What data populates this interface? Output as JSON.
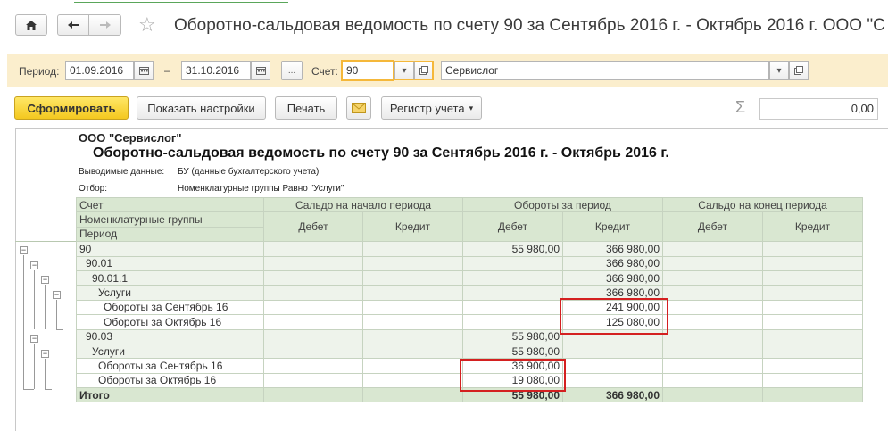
{
  "window": {
    "title": "Оборотно-сальдовая ведомость по счету 90 за Сентябрь 2016 г. - Октябрь 2016 г. ООО \"С"
  },
  "params": {
    "period_label": "Период:",
    "date_from": "01.09.2016",
    "dash": "–",
    "date_to": "31.10.2016",
    "more_button": "...",
    "account_label": "Счет:",
    "account_value": "90",
    "org_value": "Сервислог"
  },
  "toolbar": {
    "generate": "Сформировать",
    "settings": "Показать настройки",
    "print": "Печать",
    "register": "Регистр учета",
    "sum_value": "0,00"
  },
  "report": {
    "company": "ООО \"Сервислог\"",
    "title": "Оборотно-сальдовая ведомость по счету 90 за Сентябрь 2016 г. - Октябрь 2016 г.",
    "output_label": "Выводимые данные:",
    "output_value": "БУ (данные бухгалтерского учета)",
    "filter_label": "Отбор:",
    "filter_value": "Номенклатурные группы Равно \"Услуги\"",
    "headers": {
      "col_account": "Счет",
      "col_group": "Номенклатурные группы",
      "col_period": "Период",
      "opening": "Сальдо на начало периода",
      "turnover": "Обороты за период",
      "closing": "Сальдо на конец периода",
      "debit": "Дебет",
      "credit": "Кредит"
    },
    "rows": [
      {
        "label": "90",
        "od": "",
        "oc": "",
        "td": "55 980,00",
        "tc": "366 980,00",
        "cd": "",
        "cc": ""
      },
      {
        "label": "90.01",
        "od": "",
        "oc": "",
        "td": "",
        "tc": "366 980,00",
        "cd": "",
        "cc": ""
      },
      {
        "label": "90.01.1",
        "od": "",
        "oc": "",
        "td": "",
        "tc": "366 980,00",
        "cd": "",
        "cc": ""
      },
      {
        "label": "Услуги",
        "od": "",
        "oc": "",
        "td": "",
        "tc": "366 980,00",
        "cd": "",
        "cc": ""
      },
      {
        "label": "Обороты за Сентябрь 16",
        "od": "",
        "oc": "",
        "td": "",
        "tc": "241 900,00",
        "cd": "",
        "cc": ""
      },
      {
        "label": "Обороты за Октябрь 16",
        "od": "",
        "oc": "",
        "td": "",
        "tc": "125 080,00",
        "cd": "",
        "cc": ""
      },
      {
        "label": "90.03",
        "od": "",
        "oc": "",
        "td": "55 980,00",
        "tc": "",
        "cd": "",
        "cc": ""
      },
      {
        "label": "Услуги",
        "od": "",
        "oc": "",
        "td": "55 980,00",
        "tc": "",
        "cd": "",
        "cc": ""
      },
      {
        "label": "Обороты за Сентябрь 16",
        "od": "",
        "oc": "",
        "td": "36 900,00",
        "tc": "",
        "cd": "",
        "cc": ""
      },
      {
        "label": "Обороты за Октябрь 16",
        "od": "",
        "oc": "",
        "td": "19 080,00",
        "tc": "",
        "cd": "",
        "cc": ""
      }
    ],
    "total": {
      "label": "Итого",
      "td": "55 980,00",
      "tc": "366 980,00"
    }
  },
  "colors": {
    "params_bg": "#fbeecd",
    "header_bg": "#d9e7d1",
    "highlight": "#d42020",
    "primary_button": "#f4c81f"
  },
  "icons": [
    "home-icon",
    "arrow-left-icon",
    "arrow-right-icon",
    "star-icon",
    "calendar-icon",
    "dropdown-icon",
    "open-form-icon",
    "envelope-icon",
    "sigma-icon",
    "collapse-icon"
  ]
}
